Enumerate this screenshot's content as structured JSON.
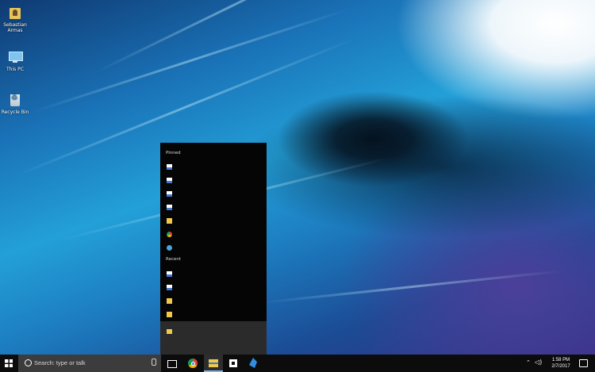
{
  "desktop": {
    "icons": [
      {
        "label": "Sebastian Armas",
        "icon": "user-folder-icon"
      },
      {
        "label": "This PC",
        "icon": "computer-icon"
      },
      {
        "label": "Recycle Bin",
        "icon": "recycle-bin-icon"
      }
    ]
  },
  "jumplist": {
    "pinned_label": "Pinned",
    "recent_label": "Recent",
    "pinned_items": [
      {
        "icon": "document-icon"
      },
      {
        "icon": "document-icon"
      },
      {
        "icon": "document-icon"
      },
      {
        "icon": "document-icon"
      },
      {
        "icon": "folder-icon"
      },
      {
        "icon": "chrome-icon"
      },
      {
        "icon": "globe-icon"
      }
    ],
    "recent_items": [
      {
        "icon": "document-icon"
      },
      {
        "icon": "document-icon"
      },
      {
        "icon": "folder-icon"
      },
      {
        "icon": "folder-icon"
      }
    ],
    "bottom_item": {
      "icon": "file-explorer-icon"
    }
  },
  "taskbar": {
    "search_placeholder": "Search: type or talk",
    "apps": [
      "task-view-icon",
      "chrome-icon",
      "file-explorer-icon",
      "store-icon",
      "app-icon"
    ],
    "active_app": "file-explorer-icon",
    "accent_color": "#7ab4ea"
  },
  "tray": {
    "time": "1:58 PM",
    "date": "2/7/2017"
  }
}
